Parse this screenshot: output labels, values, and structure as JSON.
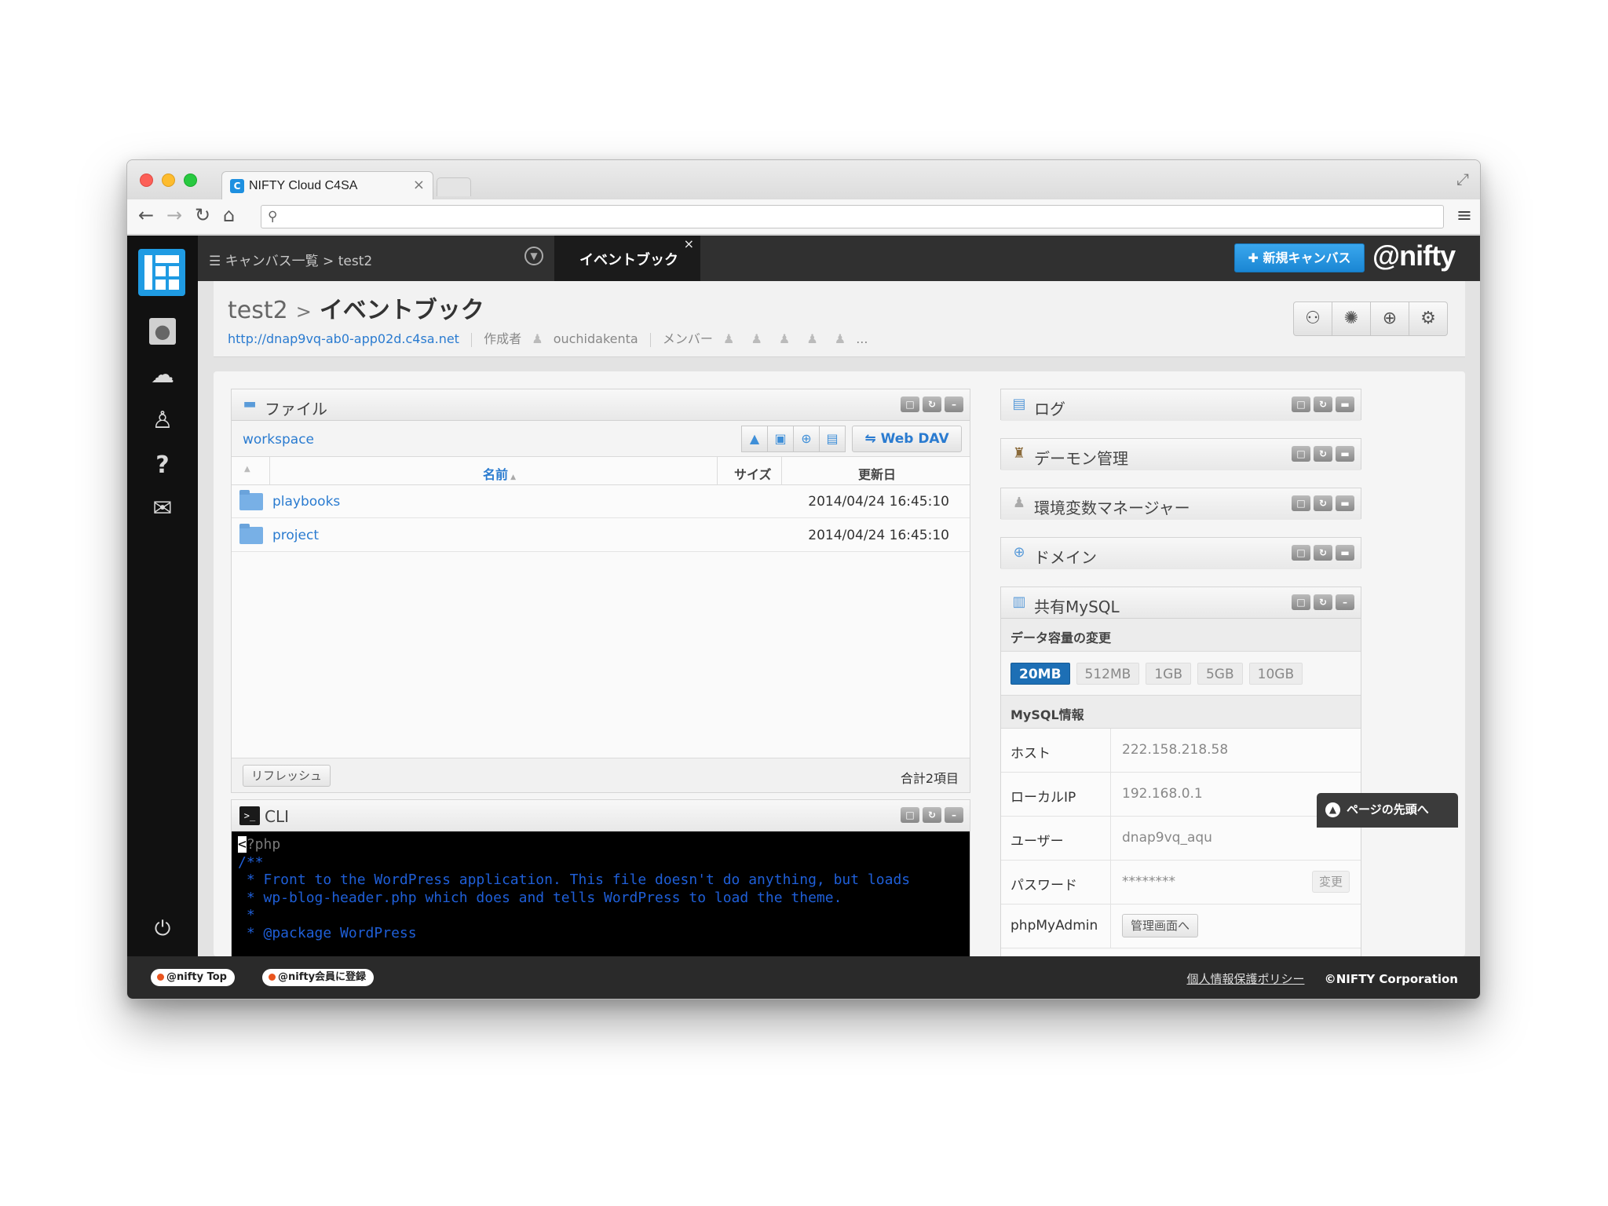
{
  "browser": {
    "tab_title": "NIFTY Cloud C4SA",
    "favicon_letter": "C",
    "tab_close": "×",
    "url": ""
  },
  "topbar": {
    "breadcrumb": "キャンバス一覧 > test2",
    "active_tab": "イベントブック",
    "tab_close": "×",
    "new_canvas_button": "新規キャンバス",
    "brand": "@nifty"
  },
  "header": {
    "crumb": "test2",
    "separator": ">",
    "title": "イベントブック",
    "url": "http://dnap9vq-ab0-app02d.c4sa.net",
    "author_label": "作成者",
    "author": "ouchidakenta",
    "members_label": "メンバー",
    "more": "..."
  },
  "file_panel": {
    "title": "ファイル",
    "path": "workspace",
    "webdav_button": "Web DAV",
    "columns": {
      "name": "名前",
      "size": "サイズ",
      "updated": "更新日"
    },
    "rows": [
      {
        "name": "playbooks",
        "size": "",
        "updated": "2014/04/24 16:45:10"
      },
      {
        "name": "project",
        "size": "",
        "updated": "2014/04/24 16:45:10"
      }
    ],
    "refresh_button": "リフレッシュ",
    "total": "合計2項目"
  },
  "cli_panel": {
    "title": "CLI",
    "lines": [
      "?php",
      "/**",
      " * Front to the WordPress application. This file doesn't do anything, but loads",
      " * wp-blog-header.php which does and tells WordPress to load the theme.",
      " *",
      " * @package WordPress"
    ]
  },
  "right_panels": {
    "log": "ログ",
    "daemon": "デーモン管理",
    "env": "環境変数マネージャー",
    "domain": "ドメイン",
    "mysql": "共有MySQL"
  },
  "mysql": {
    "capacity_heading": "データ容量の変更",
    "capacity_options": [
      "20MB",
      "512MB",
      "1GB",
      "5GB",
      "10GB"
    ],
    "capacity_selected": "20MB",
    "info_heading": "MySQL情報",
    "host_label": "ホスト",
    "host": "222.158.218.58",
    "local_ip_label": "ローカルIP",
    "local_ip": "192.168.0.1",
    "user_label": "ユーザー",
    "user": "dnap9vq_aqu",
    "password_label": "パスワード",
    "password": "********",
    "change_button": "変更",
    "pma_label": "phpMyAdmin",
    "pma_button": "管理画面へ"
  },
  "to_top": "ページの先頭へ",
  "footer": {
    "nifty_top": "@nifty Top",
    "register": "@nifty会員に登録",
    "privacy": "個人情報保護ポリシー",
    "copyright": "©NIFTY Corporation"
  },
  "colors": {
    "accent": "#1f9be3",
    "link": "#2a7bd0",
    "dark_bar": "#303030",
    "selected_capacity": "#1d6fb5"
  },
  "icons": {
    "nav": [
      "canvas-logo-icon",
      "user-icon",
      "cloud-icon",
      "hierarchy-icon",
      "help-icon",
      "mail-icon",
      "power-icon"
    ],
    "header": [
      "members-icon",
      "bug-icon",
      "upload-icon",
      "gear-icon"
    ]
  }
}
